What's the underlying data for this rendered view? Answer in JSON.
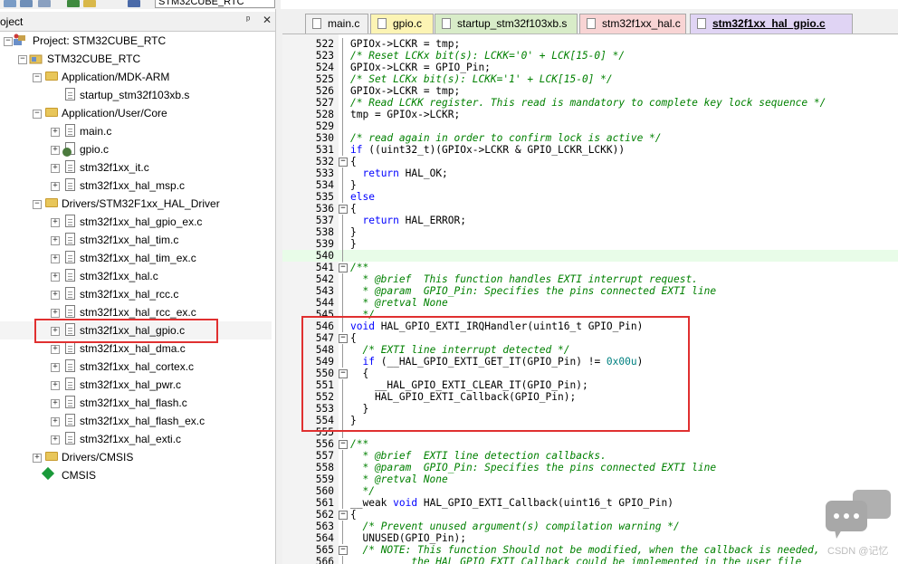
{
  "toolbar": {
    "target_name": "STM32CUBE_RTC",
    "icons": [
      "build-icon",
      "rebuild-icon",
      "batch-build-icon",
      "load-icon",
      "options-icon",
      "manage-icon",
      "pack-icon"
    ]
  },
  "project_panel": {
    "title": "oject",
    "tree": [
      {
        "label": "Project: STM32CUBE_RTC",
        "icon": "project-icon",
        "level": 0,
        "toggle": "-"
      },
      {
        "label": "STM32CUBE_RTC",
        "icon": "target-icon",
        "level": 1,
        "toggle": "-"
      },
      {
        "label": "Application/MDK-ARM",
        "icon": "folder-icon",
        "level": 2,
        "toggle": "-"
      },
      {
        "label": "startup_stm32f103xb.s",
        "icon": "file-icon",
        "level": 3,
        "toggle": ""
      },
      {
        "label": "Application/User/Core",
        "icon": "folder-icon",
        "level": 2,
        "toggle": "-"
      },
      {
        "label": "main.c",
        "icon": "file-icon",
        "level": 3,
        "toggle": "+"
      },
      {
        "label": "gpio.c",
        "icon": "gear-file-icon",
        "level": 3,
        "toggle": "+"
      },
      {
        "label": "stm32f1xx_it.c",
        "icon": "file-icon",
        "level": 3,
        "toggle": "+"
      },
      {
        "label": "stm32f1xx_hal_msp.c",
        "icon": "file-icon",
        "level": 3,
        "toggle": "+"
      },
      {
        "label": "Drivers/STM32F1xx_HAL_Driver",
        "icon": "folder-icon",
        "level": 2,
        "toggle": "-"
      },
      {
        "label": "stm32f1xx_hal_gpio_ex.c",
        "icon": "file-icon",
        "level": 3,
        "toggle": "+"
      },
      {
        "label": "stm32f1xx_hal_tim.c",
        "icon": "file-icon",
        "level": 3,
        "toggle": "+"
      },
      {
        "label": "stm32f1xx_hal_tim_ex.c",
        "icon": "file-icon",
        "level": 3,
        "toggle": "+"
      },
      {
        "label": "stm32f1xx_hal.c",
        "icon": "file-icon",
        "level": 3,
        "toggle": "+"
      },
      {
        "label": "stm32f1xx_hal_rcc.c",
        "icon": "file-icon",
        "level": 3,
        "toggle": "+"
      },
      {
        "label": "stm32f1xx_hal_rcc_ex.c",
        "icon": "file-icon",
        "level": 3,
        "toggle": "+"
      },
      {
        "label": "stm32f1xx_hal_gpio.c",
        "icon": "file-icon",
        "level": 3,
        "toggle": "+",
        "highlighted": true
      },
      {
        "label": "stm32f1xx_hal_dma.c",
        "icon": "file-icon",
        "level": 3,
        "toggle": "+"
      },
      {
        "label": "stm32f1xx_hal_cortex.c",
        "icon": "file-icon",
        "level": 3,
        "toggle": "+"
      },
      {
        "label": "stm32f1xx_hal_pwr.c",
        "icon": "file-icon",
        "level": 3,
        "toggle": "+"
      },
      {
        "label": "stm32f1xx_hal_flash.c",
        "icon": "file-icon",
        "level": 3,
        "toggle": "+"
      },
      {
        "label": "stm32f1xx_hal_flash_ex.c",
        "icon": "file-icon",
        "level": 3,
        "toggle": "+"
      },
      {
        "label": "stm32f1xx_hal_exti.c",
        "icon": "file-icon",
        "level": 3,
        "toggle": "+"
      },
      {
        "label": "Drivers/CMSIS",
        "icon": "folder-icon",
        "level": 2,
        "toggle": "+"
      },
      {
        "label": "CMSIS",
        "icon": "cmsis-icon",
        "level": 2,
        "toggle": ""
      }
    ]
  },
  "tabs": [
    {
      "label": "main.c",
      "color": "#f0f0f0",
      "active": false
    },
    {
      "label": "gpio.c",
      "color": "#fcf4b4",
      "active": false
    },
    {
      "label": "startup_stm32f103xb.s",
      "color": "#d8ecc8",
      "active": false
    },
    {
      "label": "stm32f1xx_hal.c",
      "color": "#f8d4d4",
      "active": false
    },
    {
      "label": "stm32f1xx_hal_gpio.c",
      "color": "#e0d4f4",
      "active": true
    }
  ],
  "editor": {
    "lines": [
      {
        "n": "522",
        "fold": "",
        "segs": [
          {
            "t": "GPIOx->LCKR = tmp;",
            "c": ""
          }
        ]
      },
      {
        "n": "523",
        "fold": "",
        "segs": [
          {
            "t": "/* Reset LCKx bit(s): LCKK='0' + LCK[15-0] */",
            "c": "cm"
          }
        ]
      },
      {
        "n": "524",
        "fold": "",
        "segs": [
          {
            "t": "GPIOx->LCKR = GPIO_Pin;",
            "c": ""
          }
        ]
      },
      {
        "n": "525",
        "fold": "",
        "segs": [
          {
            "t": "/* Set LCKx bit(s): LCKK='1' + LCK[15-0] */",
            "c": "cm"
          }
        ]
      },
      {
        "n": "526",
        "fold": "",
        "segs": [
          {
            "t": "GPIOx->LCKR = tmp;",
            "c": ""
          }
        ]
      },
      {
        "n": "527",
        "fold": "",
        "segs": [
          {
            "t": "/* Read LCKK register. This read is mandatory to complete key lock sequence */",
            "c": "cm"
          }
        ]
      },
      {
        "n": "528",
        "fold": "",
        "segs": [
          {
            "t": "tmp = GPIOx->LCKR;",
            "c": ""
          }
        ]
      },
      {
        "n": "529",
        "fold": "",
        "segs": []
      },
      {
        "n": "530",
        "fold": "",
        "segs": [
          {
            "t": "/* read again in order to confirm lock is active */",
            "c": "cm"
          }
        ]
      },
      {
        "n": "531",
        "fold": "",
        "segs": [
          {
            "t": "if",
            "c": "kw"
          },
          {
            "t": " ((uint32_t)(GPIOx->LCKR & GPIO_LCKR_LCKK))",
            "c": ""
          }
        ]
      },
      {
        "n": "532",
        "fold": "-",
        "segs": [
          {
            "t": "{",
            "c": ""
          }
        ]
      },
      {
        "n": "533",
        "fold": "",
        "segs": [
          {
            "t": "  ",
            "c": ""
          },
          {
            "t": "return",
            "c": "kw"
          },
          {
            "t": " HAL_OK;",
            "c": ""
          }
        ]
      },
      {
        "n": "534",
        "fold": "",
        "segs": [
          {
            "t": "}",
            "c": ""
          }
        ]
      },
      {
        "n": "535",
        "fold": "",
        "segs": [
          {
            "t": "else",
            "c": "kw"
          }
        ]
      },
      {
        "n": "536",
        "fold": "-",
        "segs": [
          {
            "t": "{",
            "c": ""
          }
        ]
      },
      {
        "n": "537",
        "fold": "",
        "segs": [
          {
            "t": "  ",
            "c": ""
          },
          {
            "t": "return",
            "c": "kw"
          },
          {
            "t": " HAL_ERROR;",
            "c": ""
          }
        ]
      },
      {
        "n": "538",
        "fold": "",
        "segs": [
          {
            "t": "}",
            "c": ""
          }
        ]
      },
      {
        "n": "539",
        "fold": "",
        "segs": [
          {
            "t": "}",
            "c": ""
          }
        ]
      },
      {
        "n": "540",
        "fold": "",
        "segs": [],
        "current": true
      },
      {
        "n": "541",
        "fold": "-",
        "segs": [
          {
            "t": "/**",
            "c": "cm"
          }
        ]
      },
      {
        "n": "542",
        "fold": "",
        "segs": [
          {
            "t": "  * @brief  This function handles EXTI interrupt request.",
            "c": "cm"
          }
        ]
      },
      {
        "n": "543",
        "fold": "",
        "segs": [
          {
            "t": "  * @param  GPIO_Pin: Specifies the pins connected EXTI line",
            "c": "cm"
          }
        ]
      },
      {
        "n": "544",
        "fold": "",
        "segs": [
          {
            "t": "  * @retval None",
            "c": "cm"
          }
        ]
      },
      {
        "n": "545",
        "fold": "",
        "segs": [
          {
            "t": "  */",
            "c": "cm"
          }
        ]
      },
      {
        "n": "546",
        "fold": "",
        "segs": [
          {
            "t": "void",
            "c": "kw"
          },
          {
            "t": " HAL_GPIO_EXTI_IRQHandler(uint16_t GPIO_Pin)",
            "c": ""
          }
        ]
      },
      {
        "n": "547",
        "fold": "-",
        "segs": [
          {
            "t": "{",
            "c": ""
          }
        ]
      },
      {
        "n": "548",
        "fold": "",
        "segs": [
          {
            "t": "  ",
            "c": ""
          },
          {
            "t": "/* EXTI line interrupt detected */",
            "c": "cm"
          }
        ]
      },
      {
        "n": "549",
        "fold": "",
        "segs": [
          {
            "t": "  ",
            "c": ""
          },
          {
            "t": "if",
            "c": "kw"
          },
          {
            "t": " (__HAL_GPIO_EXTI_GET_IT(GPIO_Pin) != ",
            "c": ""
          },
          {
            "t": "0x00u",
            "c": "num"
          },
          {
            "t": ")",
            "c": ""
          }
        ]
      },
      {
        "n": "550",
        "fold": "-",
        "segs": [
          {
            "t": "  {",
            "c": ""
          }
        ]
      },
      {
        "n": "551",
        "fold": "",
        "segs": [
          {
            "t": "    __HAL_GPIO_EXTI_CLEAR_IT(GPIO_Pin);",
            "c": ""
          }
        ]
      },
      {
        "n": "552",
        "fold": "",
        "segs": [
          {
            "t": "    HAL_GPIO_EXTI_Callback(GPIO_Pin);",
            "c": ""
          }
        ]
      },
      {
        "n": "553",
        "fold": "",
        "segs": [
          {
            "t": "  }",
            "c": ""
          }
        ]
      },
      {
        "n": "554",
        "fold": "",
        "segs": [
          {
            "t": "}",
            "c": ""
          }
        ]
      },
      {
        "n": "555",
        "fold": "",
        "segs": []
      },
      {
        "n": "556",
        "fold": "-",
        "segs": [
          {
            "t": "/**",
            "c": "cm"
          }
        ]
      },
      {
        "n": "557",
        "fold": "",
        "segs": [
          {
            "t": "  * @brief  EXTI line detection callbacks.",
            "c": "cm"
          }
        ]
      },
      {
        "n": "558",
        "fold": "",
        "segs": [
          {
            "t": "  * @param  GPIO_Pin: Specifies the pins connected EXTI line",
            "c": "cm"
          }
        ]
      },
      {
        "n": "559",
        "fold": "",
        "segs": [
          {
            "t": "  * @retval None",
            "c": "cm"
          }
        ]
      },
      {
        "n": "560",
        "fold": "",
        "segs": [
          {
            "t": "  */",
            "c": "cm"
          }
        ]
      },
      {
        "n": "561",
        "fold": "",
        "segs": [
          {
            "t": "__weak ",
            "c": ""
          },
          {
            "t": "void",
            "c": "kw"
          },
          {
            "t": " HAL_GPIO_EXTI_Callback(uint16_t GPIO_Pin)",
            "c": ""
          }
        ]
      },
      {
        "n": "562",
        "fold": "-",
        "segs": [
          {
            "t": "{",
            "c": ""
          }
        ]
      },
      {
        "n": "563",
        "fold": "",
        "segs": [
          {
            "t": "  ",
            "c": ""
          },
          {
            "t": "/* Prevent unused argument(s) compilation warning */",
            "c": "cm"
          }
        ]
      },
      {
        "n": "564",
        "fold": "",
        "segs": [
          {
            "t": "  UNUSED(GPIO_Pin);",
            "c": ""
          }
        ]
      },
      {
        "n": "565",
        "fold": "-",
        "segs": [
          {
            "t": "  ",
            "c": ""
          },
          {
            "t": "/* NOTE: This function Should not be modified, when the callback is needed,",
            "c": "cm"
          }
        ]
      },
      {
        "n": "566",
        "fold": "",
        "segs": [
          {
            "t": "          the HAL_GPIO_EXTI_Callback could be implemented in the user file",
            "c": "cm"
          }
        ]
      }
    ]
  },
  "watermark": "CSDN @记忆",
  "colors": {
    "highlight": "#e03030",
    "keyword": "#0000ff",
    "comment": "#008000",
    "number": "#008080",
    "current_line": "#e8fce8"
  }
}
